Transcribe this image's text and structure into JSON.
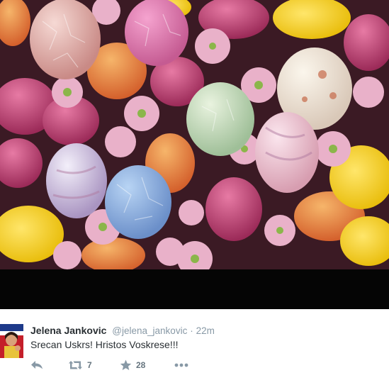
{
  "image": {
    "description_icon": "easter-eggs-photo"
  },
  "tweet": {
    "display_name": "Jelena Jankovic",
    "handle": "@jelena_jankovic",
    "separator": "·",
    "time": "22m",
    "text": "Srecan Uskrs! Hristos Voskrese!!!",
    "retweet_count": "7",
    "favorite_count": "28"
  },
  "icons": {
    "reply": "reply-icon",
    "retweet": "retweet-icon",
    "favorite": "star-icon",
    "more": "more-icon"
  },
  "colors": {
    "name": "#292f33",
    "meta": "#8899a6",
    "icon": "#8899a6"
  }
}
